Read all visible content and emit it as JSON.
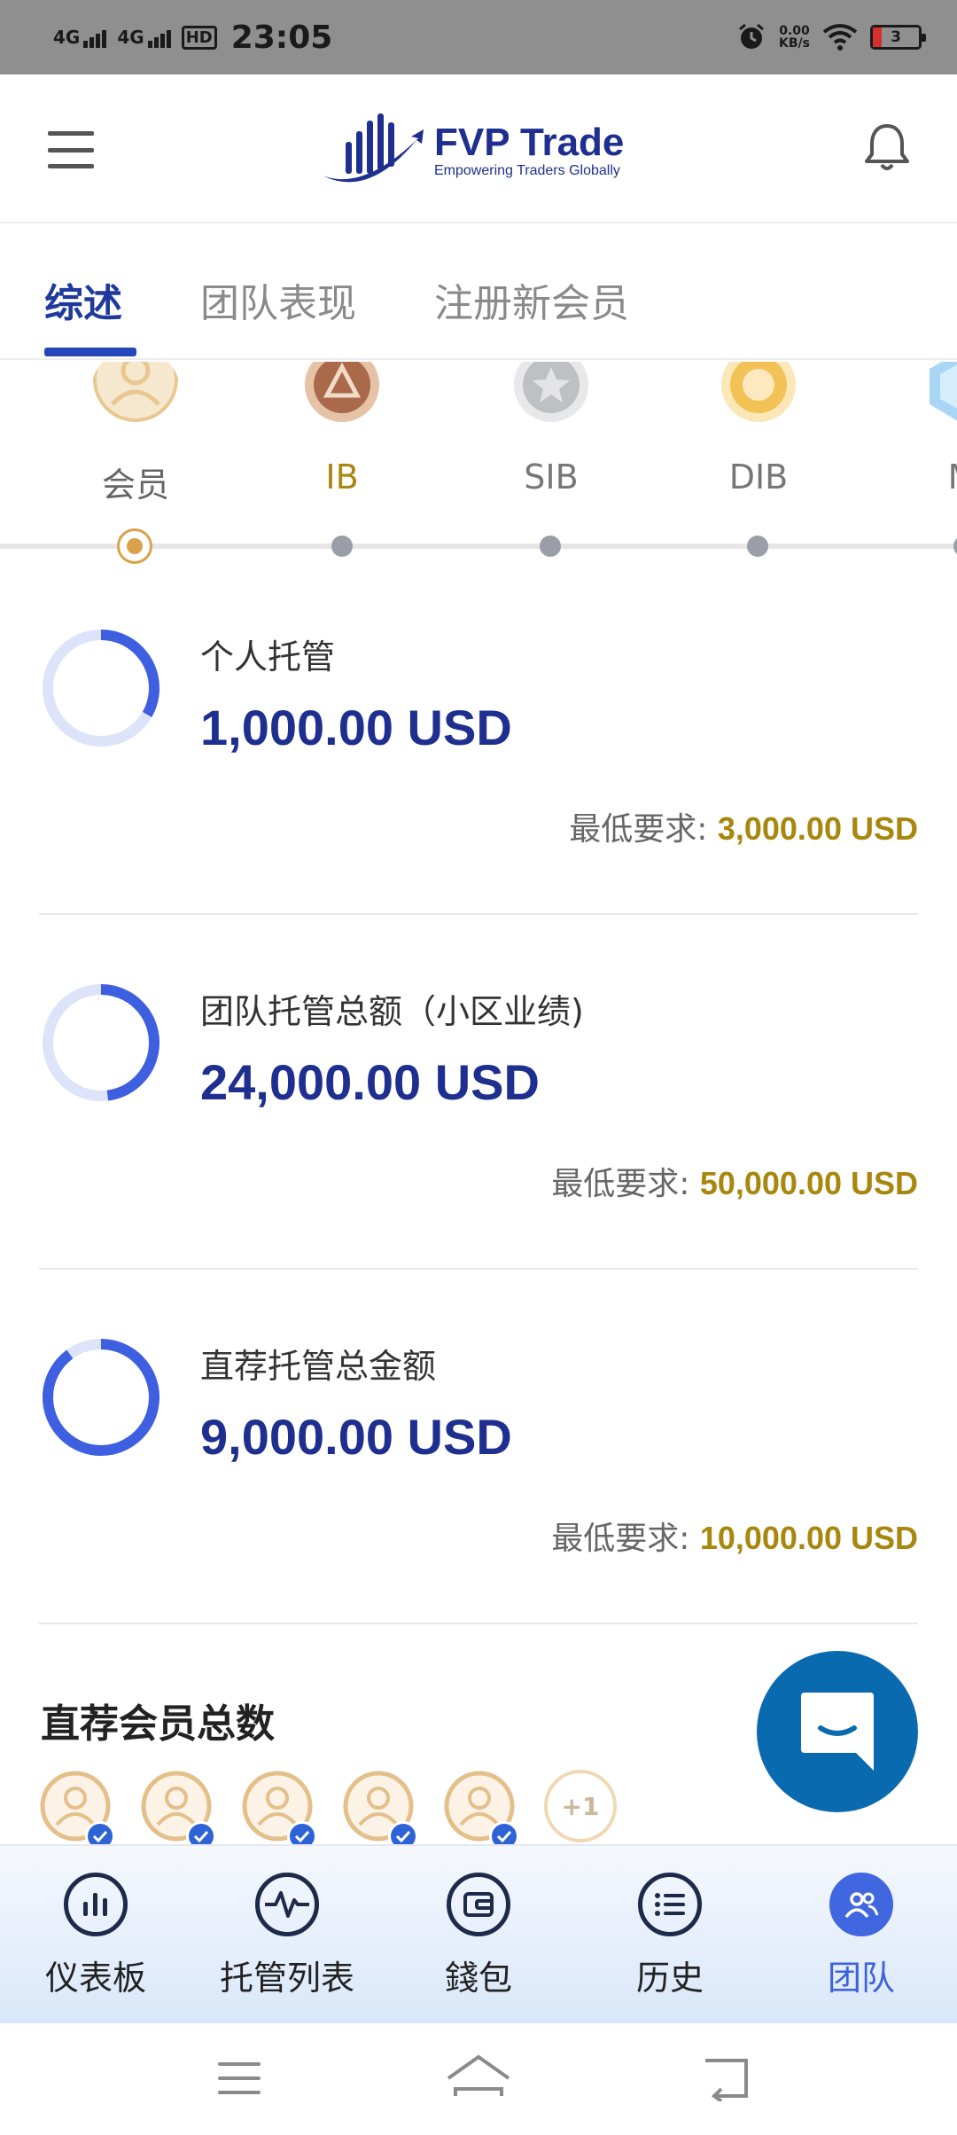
{
  "status_bar": {
    "signal1": "4G",
    "signal2": "4G",
    "hd": "HD",
    "time": "23:05",
    "speed_value": "0.00",
    "speed_unit": "KB/s",
    "battery": "3"
  },
  "header": {
    "logo_title": "FVP Trade",
    "logo_subtitle": "Empowering Traders Globally"
  },
  "tabs": [
    {
      "label": "综述",
      "active": true
    },
    {
      "label": "团队表现",
      "active": false
    },
    {
      "label": "注册新会员",
      "active": false
    }
  ],
  "levels": [
    {
      "label": "会员",
      "color": "#666666",
      "icon": "member-icon"
    },
    {
      "label": "IB",
      "color": "#a8870e",
      "icon": "bronze-badge-icon"
    },
    {
      "label": "SIB",
      "color": "#777777",
      "icon": "silver-badge-icon"
    },
    {
      "label": "DIB",
      "color": "#777777",
      "icon": "gold-badge-icon"
    },
    {
      "label": "M",
      "color": "#777777",
      "icon": "diamond-badge-icon"
    }
  ],
  "stats": [
    {
      "title": "个人托管",
      "value": "1,000.00 USD",
      "min_label": "最低要求: ",
      "min_value": "3,000.00 USD",
      "progress": 0.333
    },
    {
      "title": "团队托管总额（小区业绩)",
      "value": "24,000.00 USD",
      "min_label": "最低要求: ",
      "min_value": "50,000.00 USD",
      "progress": 0.48
    },
    {
      "title": "直荐托管总金额",
      "value": "9,000.00 USD",
      "min_label": "最低要求: ",
      "min_value": "10,000.00 USD",
      "progress": 0.9
    }
  ],
  "members": {
    "title": "直荐会员总数",
    "more": "+1"
  },
  "bottom_nav": [
    {
      "label": "仪表板",
      "icon": "bar-chart-icon",
      "active": false
    },
    {
      "label": "托管列表",
      "icon": "pulse-icon",
      "active": false
    },
    {
      "label": "錢包",
      "icon": "wallet-icon",
      "active": false
    },
    {
      "label": "历史",
      "icon": "list-icon",
      "active": false
    },
    {
      "label": "团队",
      "icon": "team-icon",
      "active": true
    }
  ],
  "colors": {
    "brand": "#1f2f8f",
    "accent": "#3d63dc",
    "gold": "#a8870e",
    "fab": "#0a6ab0"
  }
}
